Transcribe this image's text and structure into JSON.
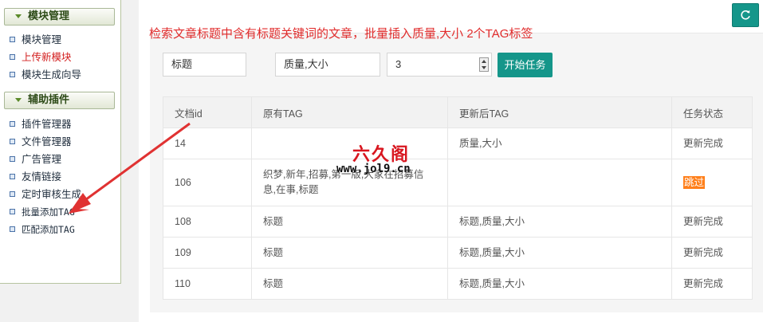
{
  "sidebar": {
    "sections": [
      {
        "title": "模块管理",
        "items": [
          "模块管理",
          "上传新模块",
          "模块生成向导"
        ]
      },
      {
        "title": "辅助插件",
        "items": [
          "插件管理器",
          "文件管理器",
          "广告管理",
          "友情链接",
          "定时审核生成",
          "批量添加TAG",
          "匹配添加TAG"
        ]
      }
    ],
    "active_item": "上传新模块"
  },
  "main": {
    "description": "检索文章标题中含有标题关键词的文章，批量插入质量,大小 2个TAG标签",
    "refresh_icon": "refresh-icon",
    "form": {
      "title_keyword": "标题",
      "tags": "质量,大小",
      "count": "3",
      "start_label": "开始任务"
    },
    "table": {
      "headers": [
        "文档id",
        "原有TAG",
        "更新后TAG",
        "任务状态"
      ],
      "rows": [
        {
          "id": "14",
          "old_tag": "",
          "new_tag": "质量,大小",
          "status": "更新完成"
        },
        {
          "id": "106",
          "old_tag": "织梦,新年,招募,第一版,大家在招募信息,在事,标题",
          "new_tag": "",
          "status": "跳过"
        },
        {
          "id": "108",
          "old_tag": "标题",
          "new_tag": "标题,质量,大小",
          "status": "更新完成"
        },
        {
          "id": "109",
          "old_tag": "标题",
          "new_tag": "标题,质量,大小",
          "status": "更新完成"
        },
        {
          "id": "110",
          "old_tag": "标题",
          "new_tag": "标题,质量,大小",
          "status": "更新完成"
        }
      ]
    }
  },
  "watermark": {
    "title": "六久阁",
    "url": "www.jol9.cn"
  },
  "colors": {
    "accent": "#15968a",
    "alert": "#e02b2b",
    "skip_badge": "#ff7f1a",
    "active_link": "#d21c1c"
  }
}
